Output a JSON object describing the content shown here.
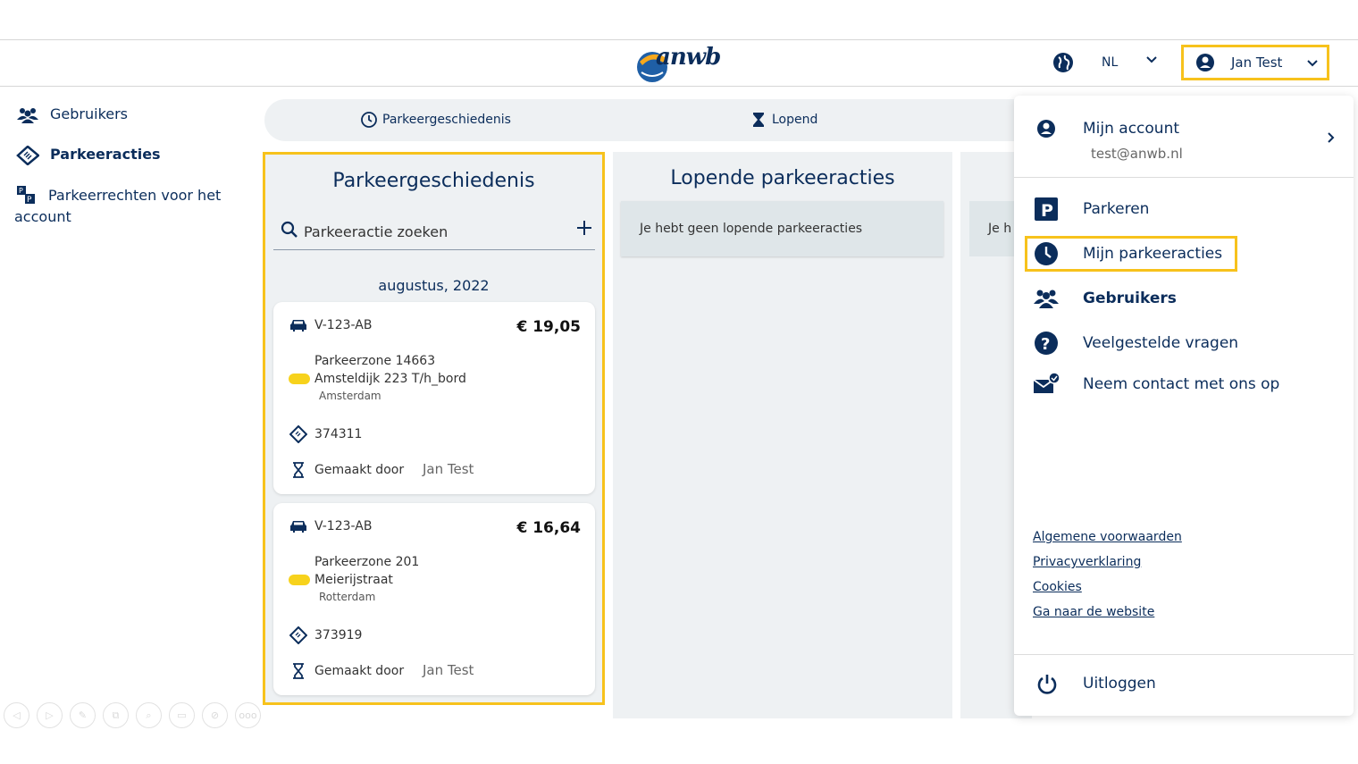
{
  "header": {
    "logo_text": "anwb",
    "lang": "NL",
    "user_name": "Jan Test"
  },
  "sidebar": {
    "items": [
      {
        "label": "Gebruikers"
      },
      {
        "label": "Parkeeracties"
      },
      {
        "label": "Parkeerrechten voor het account"
      }
    ]
  },
  "tabs": [
    {
      "label": "Parkeergeschiedenis"
    },
    {
      "label": "Lopend"
    }
  ],
  "history": {
    "title": "Parkeergeschiedenis",
    "search_placeholder": "Parkeeractie zoeken",
    "month": "augustus, 2022",
    "cards": [
      {
        "plate": "V-123-AB",
        "price": "€ 19,05",
        "zone": "Parkeerzone 14663",
        "street": "Amsteldijk 223 T/h_bord",
        "city": "Amsterdam",
        "ticket": "374311",
        "made_by_label": "Gemaakt door",
        "made_by": "Jan Test"
      },
      {
        "plate": "V-123-AB",
        "price": "€ 16,64",
        "zone": "Parkeerzone 201",
        "street": "Meierijstraat",
        "city": "Rotterdam",
        "ticket": "373919",
        "made_by_label": "Gemaakt door",
        "made_by": "Jan Test"
      }
    ]
  },
  "running": {
    "title": "Lopende parkeeracties",
    "empty_message": "Je hebt geen lopende parkeeracties",
    "third_partial": "Je h"
  },
  "dropdown": {
    "account_title": "Mijn account",
    "account_email": "test@anwb.nl",
    "items": [
      {
        "label": "Parkeren"
      },
      {
        "label": "Mijn parkeeracties"
      },
      {
        "label": "Gebruikers"
      },
      {
        "label": "Veelgestelde vragen"
      },
      {
        "label": "Neem contact met ons op"
      }
    ],
    "links": [
      {
        "label": "Algemene voorwaarden"
      },
      {
        "label": "Privacyverklaring"
      },
      {
        "label": "Cookies"
      },
      {
        "label": "Ga naar de website"
      }
    ],
    "logout": "Uitloggen"
  },
  "toolbar": {
    "buttons": [
      "back-icon",
      "forward-icon",
      "pen-icon",
      "copy-icon",
      "zoom-icon",
      "screen-icon",
      "camera-off-icon",
      "more-icon"
    ],
    "more_label": "ooo"
  },
  "colors": {
    "primary": "#0b2d5b",
    "highlight": "#f7c21c",
    "panel": "#eef1f3"
  }
}
